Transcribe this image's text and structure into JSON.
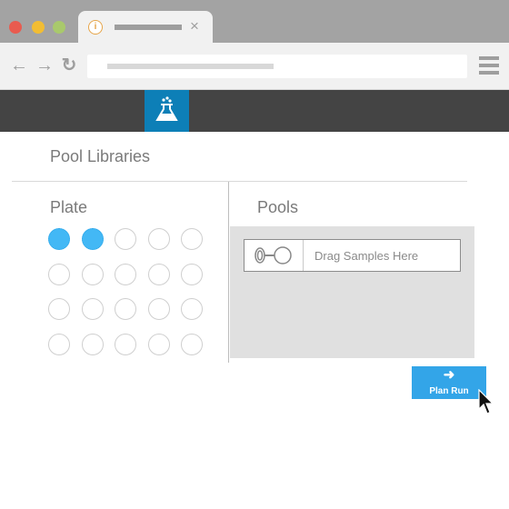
{
  "browser": {
    "tab_icon": "info-icon",
    "tab_close": "×",
    "nav": {
      "back": "←",
      "forward": "→",
      "reload": "↻"
    }
  },
  "app": {
    "logo_icon": "flask-icon"
  },
  "content": {
    "libraries_title": "Pool Libraries",
    "plate_title": "Plate",
    "pools_title": "Pools",
    "plate": {
      "rows": 4,
      "cols": 5,
      "filled_wells": [
        [
          0,
          0
        ],
        [
          0,
          1
        ]
      ]
    },
    "drag_placeholder": "Drag Samples Here",
    "plan_run_label": "Plan Run"
  },
  "colors": {
    "accent": "#33a5e8",
    "header": "#444444",
    "logo_bg": "#0d7fb7",
    "well_filled": "#43b8f5"
  }
}
